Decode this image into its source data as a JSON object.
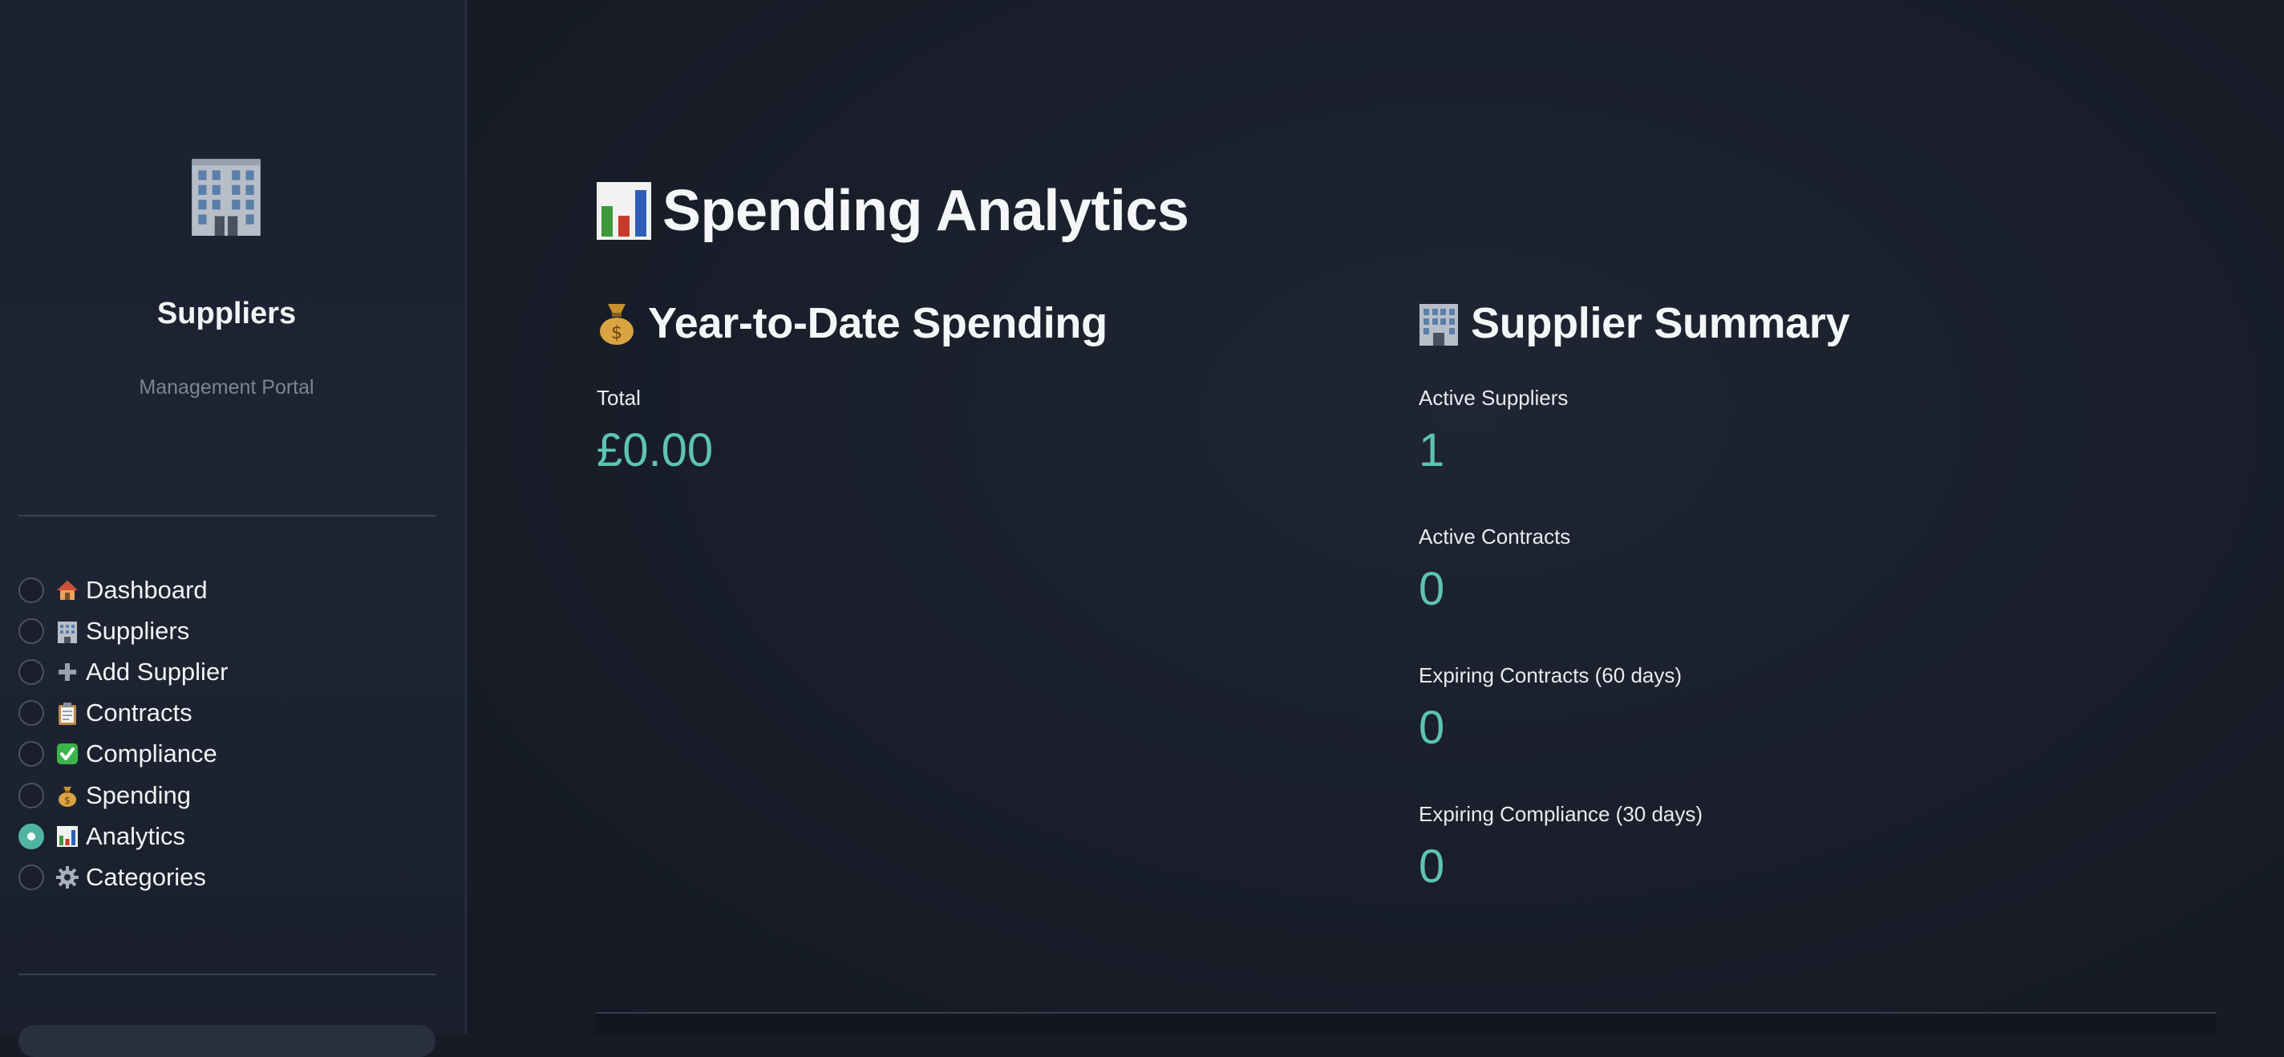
{
  "sidebar": {
    "brand_icon": "office-building-icon",
    "title": "Suppliers",
    "subtitle": "Management Portal",
    "nav_items": [
      {
        "icon": "house-icon",
        "label": "Dashboard",
        "selected": false
      },
      {
        "icon": "office-building-icon",
        "label": "Suppliers",
        "selected": false
      },
      {
        "icon": "plus-icon",
        "label": "Add Supplier",
        "selected": false
      },
      {
        "icon": "clipboard-icon",
        "label": "Contracts",
        "selected": false
      },
      {
        "icon": "check-box-icon",
        "label": "Compliance",
        "selected": false
      },
      {
        "icon": "money-bag-icon",
        "label": "Spending",
        "selected": false
      },
      {
        "icon": "bar-chart-icon",
        "label": "Analytics",
        "selected": true
      },
      {
        "icon": "gear-icon",
        "label": "Categories",
        "selected": false
      }
    ]
  },
  "main": {
    "title": "Spending Analytics",
    "title_icon": "bar-chart-icon",
    "ytd": {
      "icon": "money-bag-icon",
      "heading": "Year-to-Date Spending",
      "metrics": [
        {
          "label": "Total",
          "value": "£0.00"
        }
      ]
    },
    "summary": {
      "icon": "office-building-icon",
      "heading": "Supplier Summary",
      "metrics": [
        {
          "label": "Active Suppliers",
          "value": "1"
        },
        {
          "label": "Active Contracts",
          "value": "0"
        },
        {
          "label": "Expiring Contracts (60 days)",
          "value": "0"
        },
        {
          "label": "Expiring Compliance (30 days)",
          "value": "0"
        }
      ]
    }
  },
  "colors": {
    "accent": "#4fb5a0",
    "metric_value": "#5ec4b0",
    "background": "#161b26",
    "sidebar": "#1e2433"
  }
}
